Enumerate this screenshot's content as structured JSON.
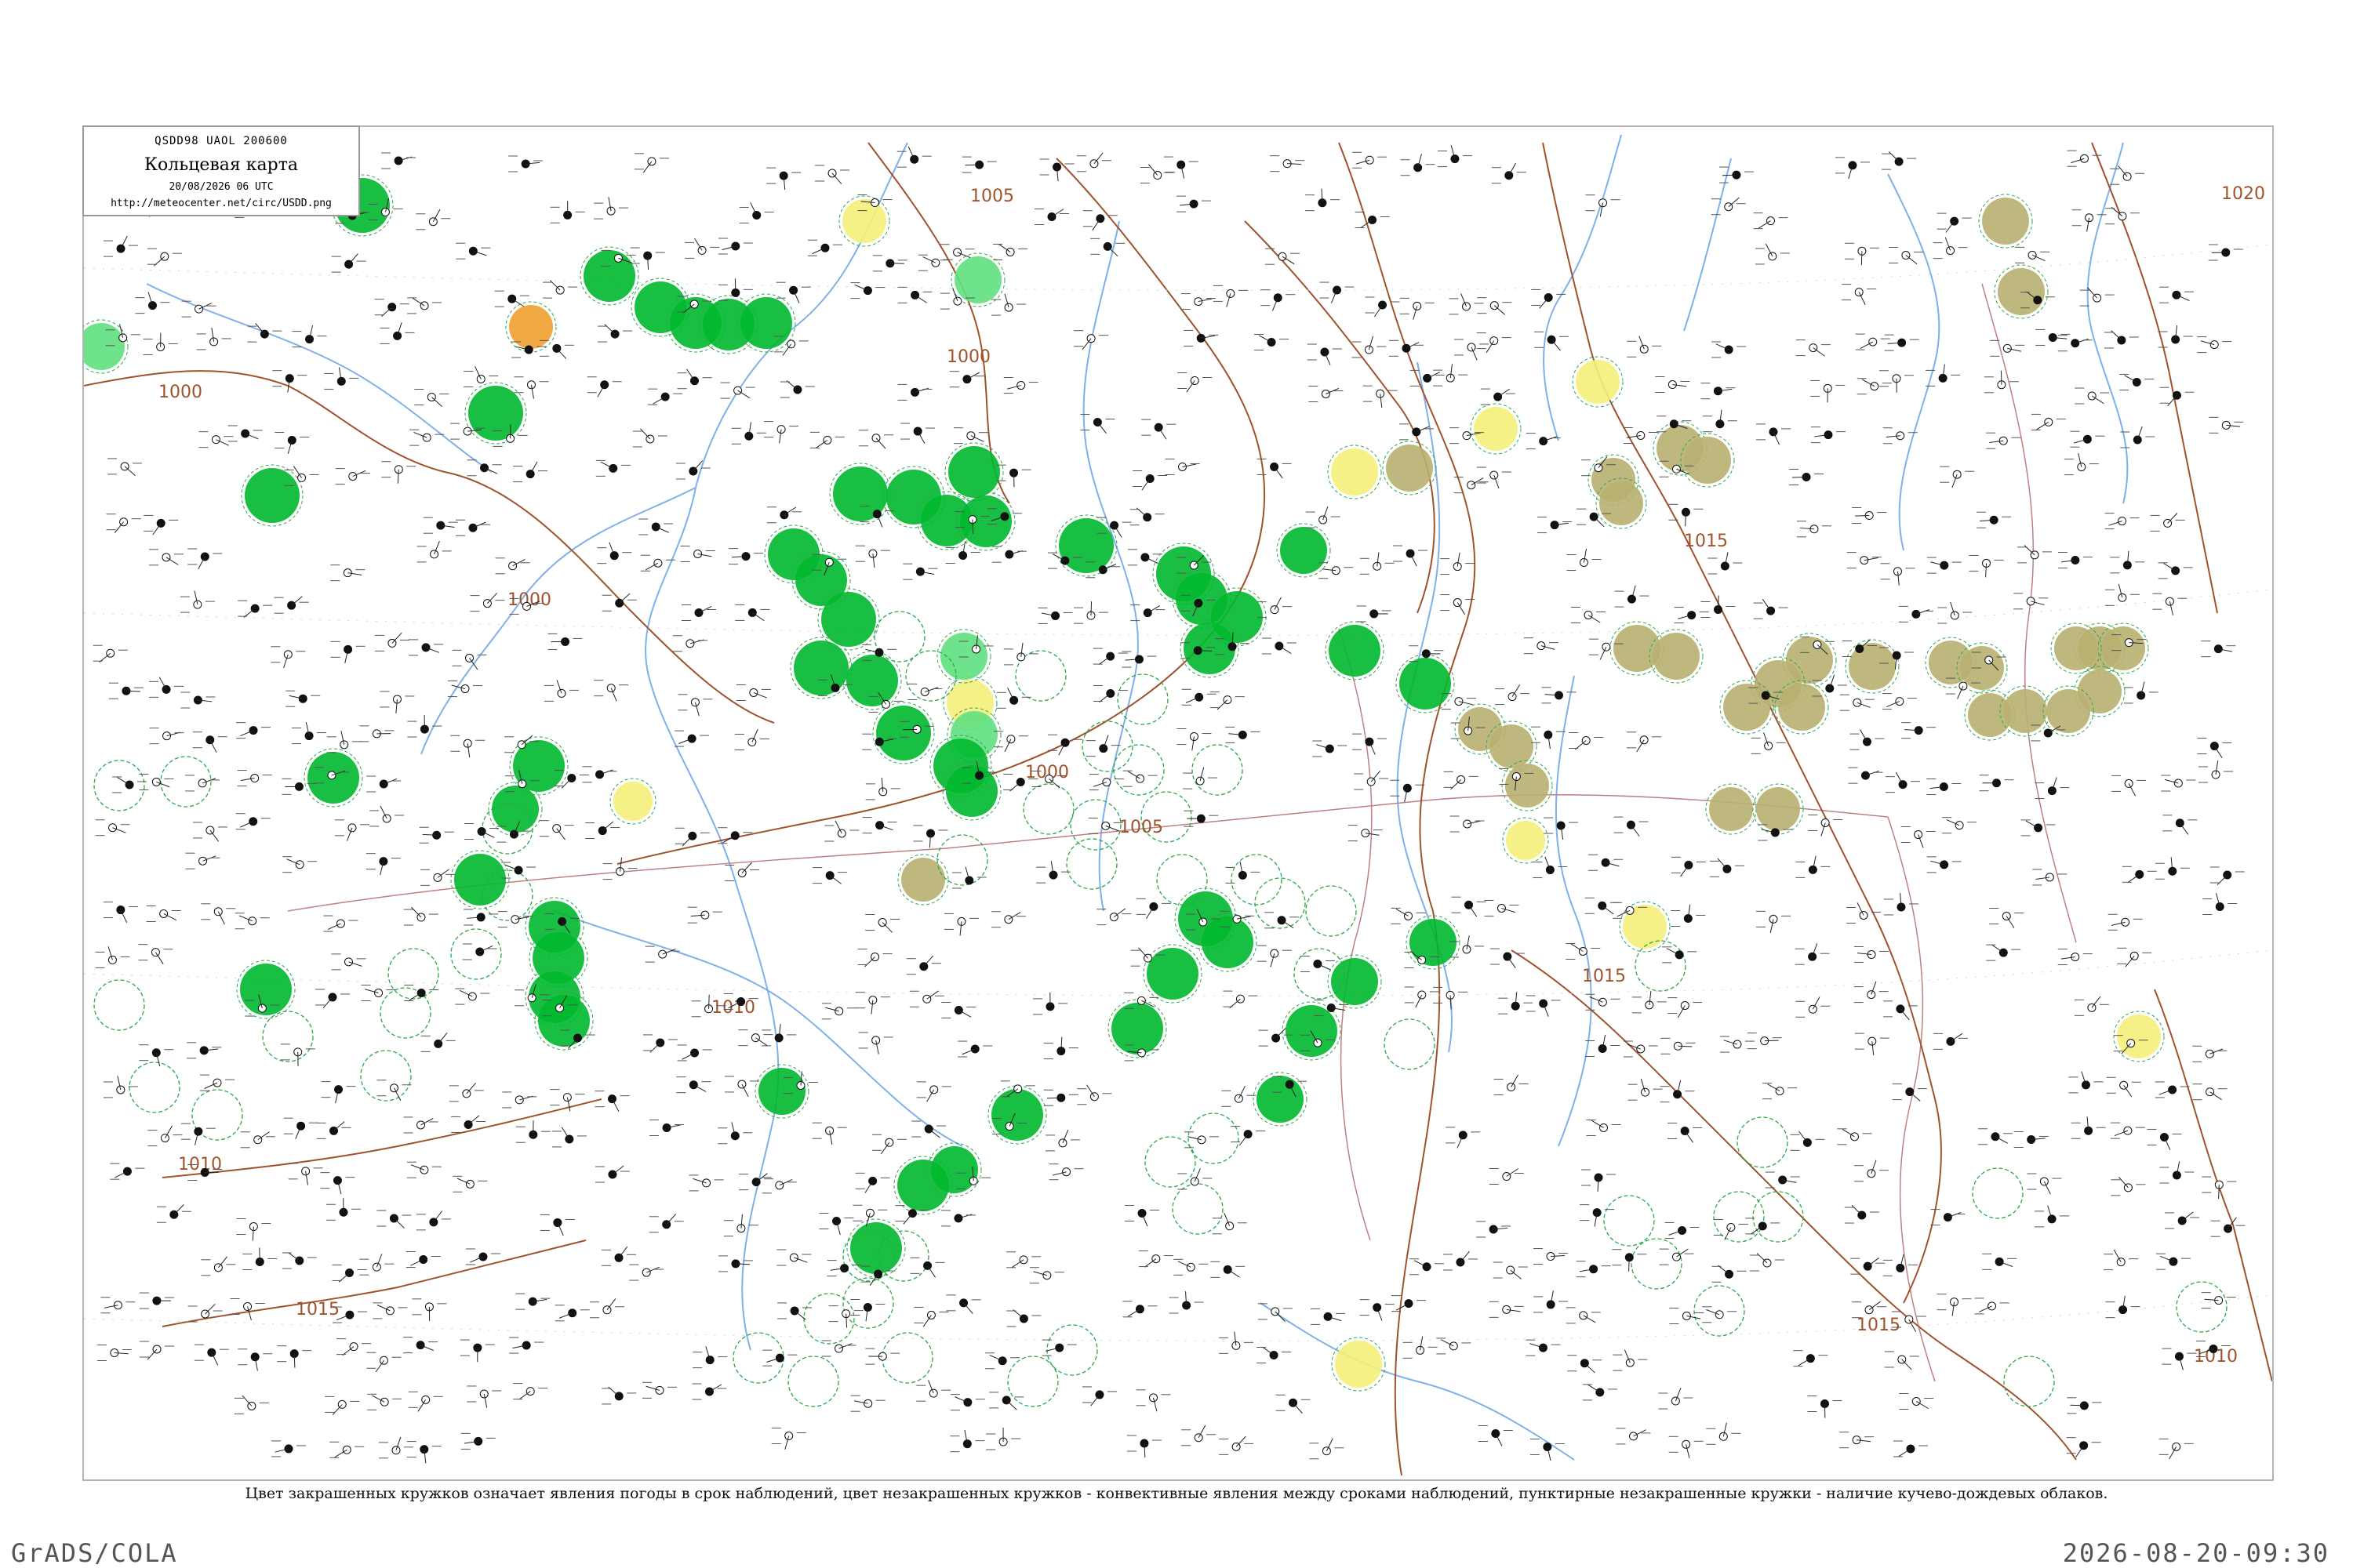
{
  "header": {
    "code_line": "QSDD98  UAOL  200600",
    "title": "Кольцевая карта",
    "datetime": "20/08/2026 06 UTC",
    "url": "http://meteocenter.net/circ/USDD.png"
  },
  "isobars": [
    {
      "label": "1000"
    },
    {
      "label": "1000"
    },
    {
      "label": "1000"
    },
    {
      "label": "1000"
    },
    {
      "label": "1005"
    },
    {
      "label": "1005"
    },
    {
      "label": "1010"
    },
    {
      "label": "1015"
    },
    {
      "label": "1015"
    },
    {
      "label": "1015"
    },
    {
      "label": "1015"
    },
    {
      "label": "1020"
    },
    {
      "label": "1010"
    },
    {
      "label": "1010"
    }
  ],
  "legend_caption": "Цвет закрашенных кружков означает явления погоды в срок наблюдений, цвет незакрашенных кружков - конвективные явления между сроками наблюдений, пунктирные незакрашенные кружки - наличие кучево-дождевых облаков.",
  "colors": {
    "rain": "#00b82e",
    "showers": "#5fe07f",
    "fog_haze": "#f5f07a",
    "smoke": "#f0a030",
    "dust": "#b8b070",
    "thunder_ring": "#2aa84a",
    "isobar": "#a0522d",
    "river": "#7fb0e8"
  },
  "footer": {
    "left": "GrADS/COLA",
    "right": "2026-08-20-09:30"
  }
}
